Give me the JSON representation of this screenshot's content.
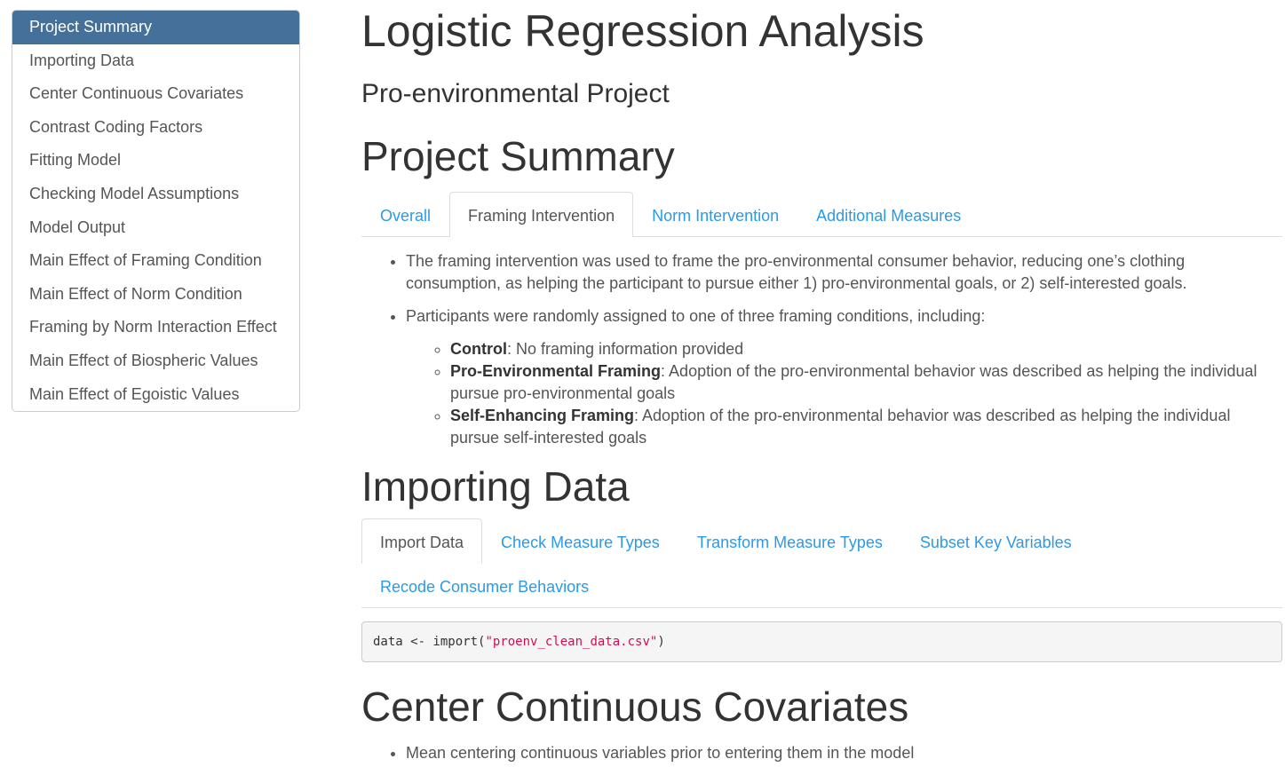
{
  "toc": [
    "Project Summary",
    "Importing Data",
    "Center Continuous Covariates",
    "Contrast Coding Factors",
    "Fitting Model",
    "Checking Model Assumptions",
    "Model Output",
    "Main Effect of Framing Condition",
    "Main Effect of Norm Condition",
    "Framing by Norm Interaction Effect",
    "Main Effect of Biospheric Values",
    "Main Effect of Egoistic Values"
  ],
  "title": "Logistic Regression Analysis",
  "subtitle": "Pro-environmental Project",
  "summary": {
    "heading": "Project Summary",
    "tabs": [
      "Overall",
      "Framing Intervention",
      "Norm Intervention",
      "Additional Measures"
    ],
    "bullet1": "The framing intervention was used to frame the pro-environmental consumer behavior, reducing one’s clothing consumption, as helping the participant to pursue either 1) pro-environmental goals, or 2) self-interested goals.",
    "bullet2": "Participants were randomly assigned to one of three framing conditions, including:",
    "conditions": [
      {
        "name": "Control",
        "desc": ": No framing information provided"
      },
      {
        "name": "Pro-Environmental Framing",
        "desc": ": Adoption of the pro-environmental behavior was described as helping the individual pursue pro-environmental goals"
      },
      {
        "name": "Self-Enhancing Framing",
        "desc": ": Adoption of the pro-environmental behavior was described as helping the individual pursue self-interested goals"
      }
    ]
  },
  "importing": {
    "heading": "Importing Data",
    "tabs": [
      "Import Data",
      "Check Measure Types",
      "Transform Measure Types",
      "Subset Key Variables",
      "Recode Consumer Behaviors"
    ],
    "code_prefix": "data <- import(",
    "code_string": "\"proenv_clean_data.csv\"",
    "code_suffix": ")"
  },
  "center": {
    "heading": "Center Continuous Covariates",
    "bullet1": "Mean centering continuous variables prior to entering them in the model"
  }
}
